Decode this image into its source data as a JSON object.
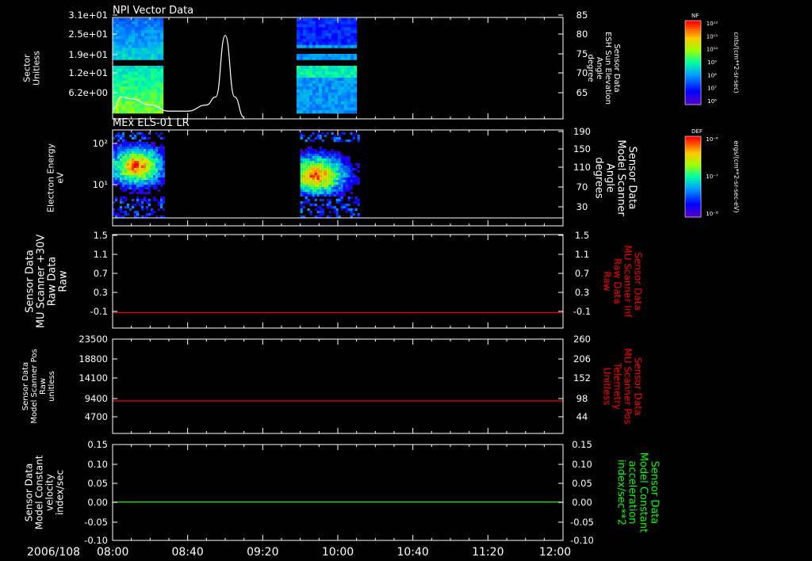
{
  "colors": {
    "background": "#000000",
    "axis": "#ffffff",
    "red_trace": "#ff0000",
    "green_trace": "#00ff00",
    "right_label_p3": "#ff0000",
    "right_label_p4": "#ff0000",
    "right_label_p5": "#00ff00"
  },
  "bottom_axis": {
    "date": "2006/108",
    "ticks": [
      "08:00",
      "08:40",
      "09:20",
      "10:00",
      "10:40",
      "11:20",
      "12:00"
    ]
  },
  "colorbars": [
    {
      "tag": "NF",
      "unit": "cnts/(cm**2-sr-sec)",
      "ticks": [
        "10¹²",
        "10¹¹",
        "10¹⁰",
        "10⁹",
        "10⁸",
        "10⁷",
        "10⁶"
      ],
      "scale": "log"
    },
    {
      "tag": "DEF",
      "unit": "ergs/(cm**2-sr-sec-eV)",
      "ticks": [
        "10⁻⁶",
        "10⁻⁷",
        "10⁻⁸"
      ],
      "scale": "log"
    }
  ],
  "chart_data": [
    {
      "type": "heatmap",
      "title": "NPI Vector Data",
      "ylabel": [
        "Sector",
        "Unitless"
      ],
      "yticks": [
        "3.1e+01",
        "2.5e+01",
        "1.9e+01",
        "1.2e+01",
        "6.2e+00"
      ],
      "y2label": [
        "Sensor Data",
        "ESH Sun Elevation",
        "Angle",
        "degree"
      ],
      "y2ticks": [
        "85",
        "80",
        "75",
        "70",
        "65"
      ],
      "y2lim": [
        61,
        85
      ],
      "data_intervals": [
        [
          "08:00",
          "08:27"
        ],
        [
          "09:38",
          "10:10"
        ]
      ],
      "line": {
        "name": "ESH Sun Elevation Angle",
        "x": [
          "08:00",
          "08:05",
          "08:10",
          "08:20",
          "08:30",
          "08:40",
          "08:50",
          "08:55",
          "09:00",
          "09:05",
          "09:10"
        ],
        "y": [
          63,
          66,
          65.5,
          64,
          62.5,
          62.5,
          64,
          66,
          81,
          66,
          61
        ]
      }
    },
    {
      "type": "heatmap",
      "title": "MEx ELS-01 LR",
      "ylabel": [
        "Electron Energy",
        "eV"
      ],
      "yticks": [
        "10²",
        "10¹"
      ],
      "y2label": [
        "Sensor Data",
        "Model Scanner",
        "Angle",
        "degrees"
      ],
      "y2ticks": [
        "190",
        "150",
        "110",
        "70",
        "30"
      ],
      "data_intervals": [
        [
          "08:00",
          "08:27"
        ],
        [
          "09:40",
          "10:11"
        ]
      ]
    },
    {
      "type": "line",
      "ylabel": [
        "Sensor Data",
        "MU Scanner +30V",
        "Raw Data",
        "Raw"
      ],
      "y2label": [
        "Sensor Data",
        "MU Scanner Inf",
        "Raw Data",
        "Raw"
      ],
      "yticks": [
        "1.5",
        "1.1",
        "0.7",
        "0.3",
        "-0.1"
      ],
      "y2ticks": [
        "1.5",
        "1.1",
        "0.7",
        "0.3",
        "-0.1"
      ],
      "ylim": [
        -0.3,
        1.5
      ],
      "series": [
        {
          "x": [
            "08:00",
            "12:00"
          ],
          "y": [
            0.0,
            0.0
          ],
          "color": "#ff0000"
        }
      ]
    },
    {
      "type": "line",
      "ylabel": [
        "Sensor Data",
        "Model Scanner Pos",
        "Raw",
        "unitless"
      ],
      "y2label": [
        "Sensor Data",
        "MU Scanner Pos",
        "Telemetry",
        "Unitless"
      ],
      "yticks": [
        "23500",
        "18800",
        "14100",
        "9400",
        "4700"
      ],
      "y2ticks": [
        "260",
        "206",
        "152",
        "98",
        "44"
      ],
      "ylim": [
        0,
        23500
      ],
      "series": [
        {
          "x": [
            "08:00",
            "12:00"
          ],
          "y": [
            8100,
            8100
          ],
          "color": "#ff0000"
        }
      ]
    },
    {
      "type": "line",
      "ylabel": [
        "Sensor Data",
        "Model Constant",
        "velocity",
        "index/sec"
      ],
      "y2label": [
        "Sensor Data",
        "Model Constant",
        "acceleration",
        "index/sec**2"
      ],
      "yticks": [
        "0.15",
        "0.10",
        "0.05",
        "0.00",
        "-0.05",
        "-0.10"
      ],
      "y2ticks": [
        "0.15",
        "0.10",
        "0.05",
        "0.00",
        "-0.05",
        "-0.10"
      ],
      "ylim": [
        -0.1,
        0.15
      ],
      "series": [
        {
          "x": [
            "08:00",
            "12:00"
          ],
          "y": [
            0.0,
            0.0
          ],
          "color": "#00ff00"
        }
      ]
    }
  ]
}
